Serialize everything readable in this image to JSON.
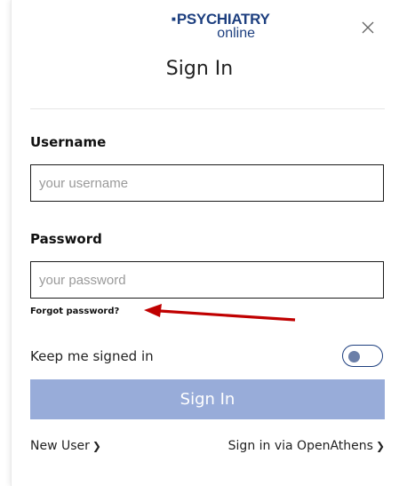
{
  "logo": {
    "top": "PSYCHIATRY",
    "bottom": "online"
  },
  "dialog": {
    "title": "Sign In"
  },
  "username": {
    "label": "Username",
    "placeholder": "your username",
    "value": ""
  },
  "password": {
    "label": "Password",
    "placeholder": "your password",
    "value": ""
  },
  "forgot_password": "Forgot password?",
  "keep_signed_in": {
    "label": "Keep me signed in",
    "enabled": false
  },
  "sign_in_button": "Sign In",
  "footer": {
    "new_user": "New User",
    "openathens": "Sign in via OpenAthens"
  },
  "colors": {
    "brand": "#1d3f7f",
    "button": "#98acd9",
    "annotation_arrow": "#c00000"
  },
  "icons": {
    "close": "close-icon",
    "chevron": "chevron-right-icon",
    "arrow": "annotation-arrow"
  }
}
